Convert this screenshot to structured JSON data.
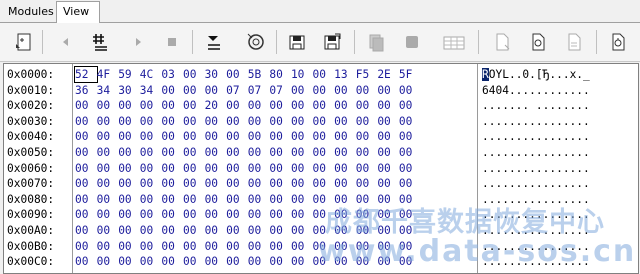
{
  "tabs": [
    {
      "label": "Modules"
    },
    {
      "label": "View"
    }
  ],
  "toolbar": {
    "buttons": [
      {
        "icon": "page-properties-icon"
      },
      {
        "icon": "back-arrow-icon"
      },
      {
        "icon": "goto-offset-icon"
      },
      {
        "icon": "forward-arrow-icon"
      },
      {
        "icon": "stop-icon"
      },
      {
        "icon": "goto-end-icon"
      },
      {
        "icon": "find-icon"
      },
      {
        "icon": "save-icon"
      },
      {
        "icon": "save-as-icon"
      },
      {
        "icon": "copy-icon"
      },
      {
        "icon": "stop-block-icon"
      },
      {
        "icon": "hex-table-icon"
      },
      {
        "icon": "new-document-icon"
      },
      {
        "icon": "document-refresh-icon"
      },
      {
        "icon": "document-zoom-icon"
      },
      {
        "icon": "document-options-icon"
      }
    ]
  },
  "hex": {
    "rows": [
      {
        "addr": "0x0000:",
        "bytes": [
          "52",
          "4F",
          "59",
          "4C",
          "03",
          "00",
          "30",
          "00",
          "5B",
          "80",
          "10",
          "00",
          "13",
          "F5",
          "2E",
          "5F"
        ],
        "ascii": "ROYL..0.[Ђ...х._"
      },
      {
        "addr": "0x0010:",
        "bytes": [
          "36",
          "34",
          "30",
          "34",
          "00",
          "00",
          "00",
          "07",
          "07",
          "07",
          "00",
          "00",
          "00",
          "00",
          "00",
          "00"
        ],
        "ascii": "6404............"
      },
      {
        "addr": "0x0020:",
        "bytes": [
          "00",
          "00",
          "00",
          "00",
          "00",
          "00",
          "20",
          "00",
          "00",
          "00",
          "00",
          "00",
          "00",
          "00",
          "00",
          "00"
        ],
        "ascii": "....... ........"
      },
      {
        "addr": "0x0030:",
        "bytes": [
          "00",
          "00",
          "00",
          "00",
          "00",
          "00",
          "00",
          "00",
          "00",
          "00",
          "00",
          "00",
          "00",
          "00",
          "00",
          "00"
        ],
        "ascii": "................"
      },
      {
        "addr": "0x0040:",
        "bytes": [
          "00",
          "00",
          "00",
          "00",
          "00",
          "00",
          "00",
          "00",
          "00",
          "00",
          "00",
          "00",
          "00",
          "00",
          "00",
          "00"
        ],
        "ascii": "................"
      },
      {
        "addr": "0x0050:",
        "bytes": [
          "00",
          "00",
          "00",
          "00",
          "00",
          "00",
          "00",
          "00",
          "00",
          "00",
          "00",
          "00",
          "00",
          "00",
          "00",
          "00"
        ],
        "ascii": "................"
      },
      {
        "addr": "0x0060:",
        "bytes": [
          "00",
          "00",
          "00",
          "00",
          "00",
          "00",
          "00",
          "00",
          "00",
          "00",
          "00",
          "00",
          "00",
          "00",
          "00",
          "00"
        ],
        "ascii": "................"
      },
      {
        "addr": "0x0070:",
        "bytes": [
          "00",
          "00",
          "00",
          "00",
          "00",
          "00",
          "00",
          "00",
          "00",
          "00",
          "00",
          "00",
          "00",
          "00",
          "00",
          "00"
        ],
        "ascii": "................"
      },
      {
        "addr": "0x0080:",
        "bytes": [
          "00",
          "00",
          "00",
          "00",
          "00",
          "00",
          "00",
          "00",
          "00",
          "00",
          "00",
          "00",
          "00",
          "00",
          "00",
          "00"
        ],
        "ascii": "................"
      },
      {
        "addr": "0x0090:",
        "bytes": [
          "00",
          "00",
          "00",
          "00",
          "00",
          "00",
          "00",
          "00",
          "00",
          "00",
          "00",
          "00",
          "00",
          "00",
          "00",
          "00"
        ],
        "ascii": "................"
      },
      {
        "addr": "0x00A0:",
        "bytes": [
          "00",
          "00",
          "00",
          "00",
          "00",
          "00",
          "00",
          "00",
          "00",
          "00",
          "00",
          "00",
          "00",
          "00",
          "00",
          "00"
        ],
        "ascii": "................"
      },
      {
        "addr": "0x00B0:",
        "bytes": [
          "00",
          "00",
          "00",
          "00",
          "00",
          "00",
          "00",
          "00",
          "00",
          "00",
          "00",
          "00",
          "00",
          "00",
          "00",
          "00"
        ],
        "ascii": "................"
      },
      {
        "addr": "0x00C0:",
        "bytes": [
          "00",
          "00",
          "00",
          "00",
          "00",
          "00",
          "00",
          "00",
          "00",
          "00",
          "00",
          "00",
          "00",
          "00",
          "00",
          "00"
        ],
        "ascii": "................"
      }
    ]
  },
  "watermark": {
    "line1": "成都千喜数据恢复中心",
    "line2": "www.data-sos.cn",
    "color": "#8aaedc"
  }
}
